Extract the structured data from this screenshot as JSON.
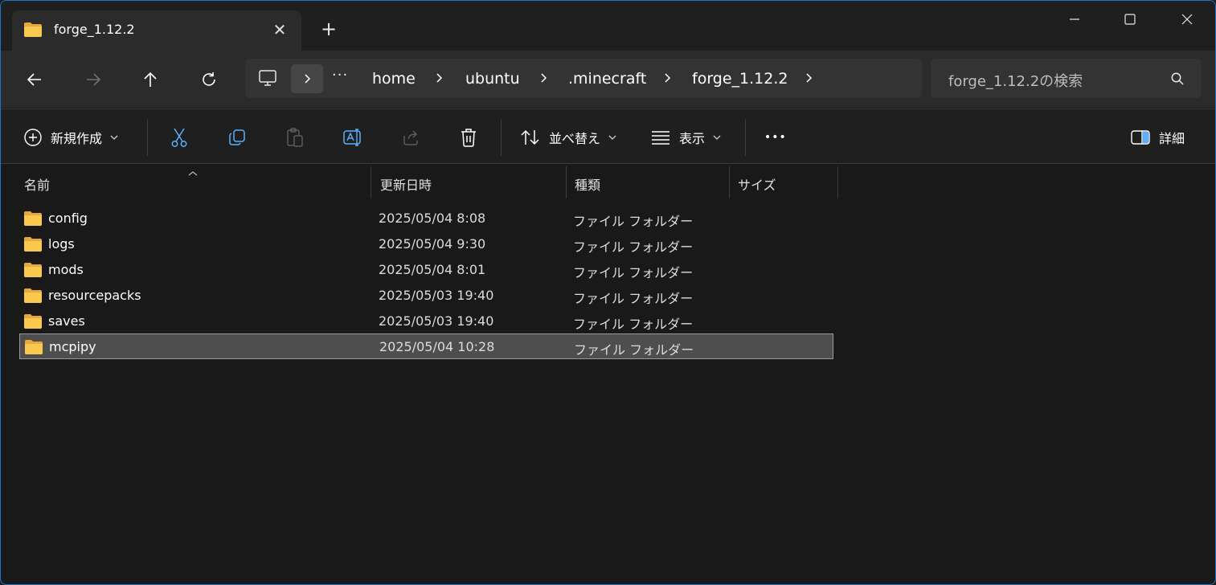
{
  "window": {
    "tab_title": "forge_1.12.2",
    "tab_close": "✕",
    "new_tab": "+",
    "colors": {
      "accent_border": "#1e74c8",
      "folder_yellow": "#f6c54a",
      "selection": "#4e4e4e"
    }
  },
  "address": {
    "ellipsis": "···",
    "breadcrumbs": [
      "home",
      "ubuntu",
      ".minecraft",
      "forge_1.12.2"
    ],
    "search_placeholder": "forge_1.12.2の検索"
  },
  "toolbar": {
    "new_label": "新規作成",
    "sort_label": "並べ替え",
    "view_label": "表示",
    "more_label": "•••",
    "details_label": "詳細",
    "icons": [
      "new-icon",
      "cut-icon",
      "copy-icon",
      "paste-icon",
      "rename-icon",
      "share-icon",
      "delete-icon",
      "sort-icon",
      "view-icon",
      "more-icon",
      "details-pane-icon"
    ]
  },
  "columns": {
    "name": "名前",
    "modified": "更新日時",
    "type": "種類",
    "size": "サイズ"
  },
  "files": [
    {
      "name": "config",
      "modified": "2025/05/04 8:08",
      "type": "ファイル フォルダー"
    },
    {
      "name": "logs",
      "modified": "2025/05/04 9:30",
      "type": "ファイル フォルダー"
    },
    {
      "name": "mods",
      "modified": "2025/05/04 8:01",
      "type": "ファイル フォルダー"
    },
    {
      "name": "resourcepacks",
      "modified": "2025/05/03 19:40",
      "type": "ファイル フォルダー"
    },
    {
      "name": "saves",
      "modified": "2025/05/03 19:40",
      "type": "ファイル フォルダー"
    },
    {
      "name": "mcpipy",
      "modified": "2025/05/04 10:28",
      "type": "ファイル フォルダー",
      "selected": true
    }
  ]
}
